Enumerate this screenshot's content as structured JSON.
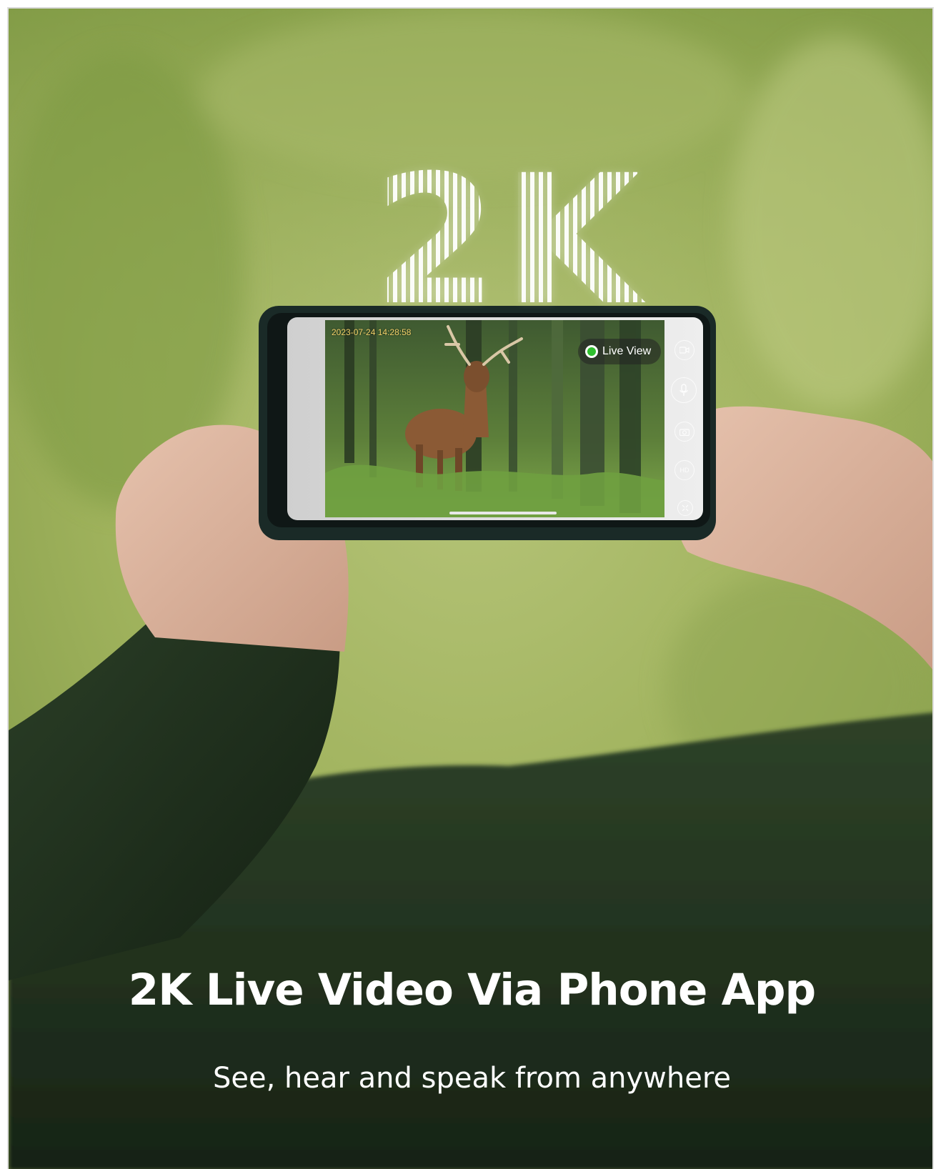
{
  "hero_badge": "2K",
  "phone_screen": {
    "timestamp": "2023-07-24  14:28:58",
    "live_label": "Live View",
    "hd_label": "HD",
    "icons": [
      "video-icon",
      "microphone-icon",
      "camera-icon",
      "hd-icon",
      "fullscreen-exit-icon"
    ]
  },
  "headline": "2K Live Video Via Phone App",
  "subheadline": "See, hear and speak from anywhere",
  "colors": {
    "background_green": "#9aac57",
    "sleeve_green": "#1f2e1d",
    "live_dot": "#2fbf2f",
    "timestamp": "#f3d36b"
  }
}
